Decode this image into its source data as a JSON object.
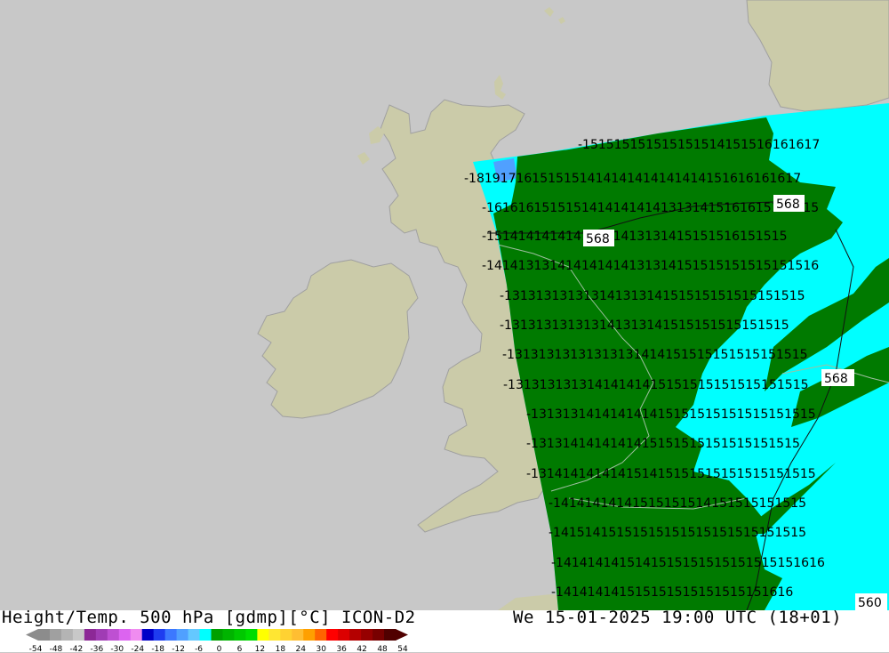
{
  "header": {
    "title_left": "Height/Temp. 500 hPa [gdmp][°C] ICON-D2",
    "title_right": "We 15-01-2025 19:00 UTC (18+01)"
  },
  "legend": {
    "ticks": [
      "-54",
      "-48",
      "-42",
      "-36",
      "-30",
      "-24",
      "-18",
      "-12",
      "-6",
      "0",
      "6",
      "12",
      "18",
      "24",
      "30",
      "36",
      "42",
      "48",
      "54"
    ],
    "colors": [
      "#8c8c8c",
      "#a0a0a0",
      "#b4b4b4",
      "#c8c8c8",
      "#8c2896",
      "#a03cb4",
      "#be50d2",
      "#dc64f0",
      "#f08cf0",
      "#0000c8",
      "#1e3cf0",
      "#3c78ff",
      "#50a0ff",
      "#64c8ff",
      "#00ffff",
      "#00a000",
      "#00b400",
      "#00c800",
      "#00dc00",
      "#ffff00",
      "#ffe632",
      "#ffd232",
      "#ffbe32",
      "#ffa000",
      "#ff6400",
      "#ff0000",
      "#dc0000",
      "#b40000",
      "#960000",
      "#780000",
      "#500000"
    ]
  },
  "contour_labels": [
    "568",
    "568",
    "568",
    "560"
  ],
  "colors": {
    "land": "#cbcba9",
    "sea": "#c8c8c8",
    "cold": "#00ffff",
    "warm": "#007a00"
  },
  "temperature_rows": [
    "-151515151515151514151516161617",
    "-181917161515151414141414141414151616161617",
    "-161616151515141414141413131415161615151515",
    "-15141414141414141413131415151516151515",
    "-141413131414141414131314151515151515151516",
    "-13131313131314131314151515151515151515",
    "-131313131313141313141515151515151515",
    "-13131313131313131414151515151515151515",
    "-13131313131414141415151515151515151515",
    "-131313141414141415151515151515151515",
    "-1313141414141415151515151515151515",
    "-131414141414151415151515151515151515",
    "-14141414141515151514151515151515",
    "-14151415151515151515151515151515",
    "-1414141415141515151515151515151616",
    "-141414141515151515151515151616"
  ]
}
